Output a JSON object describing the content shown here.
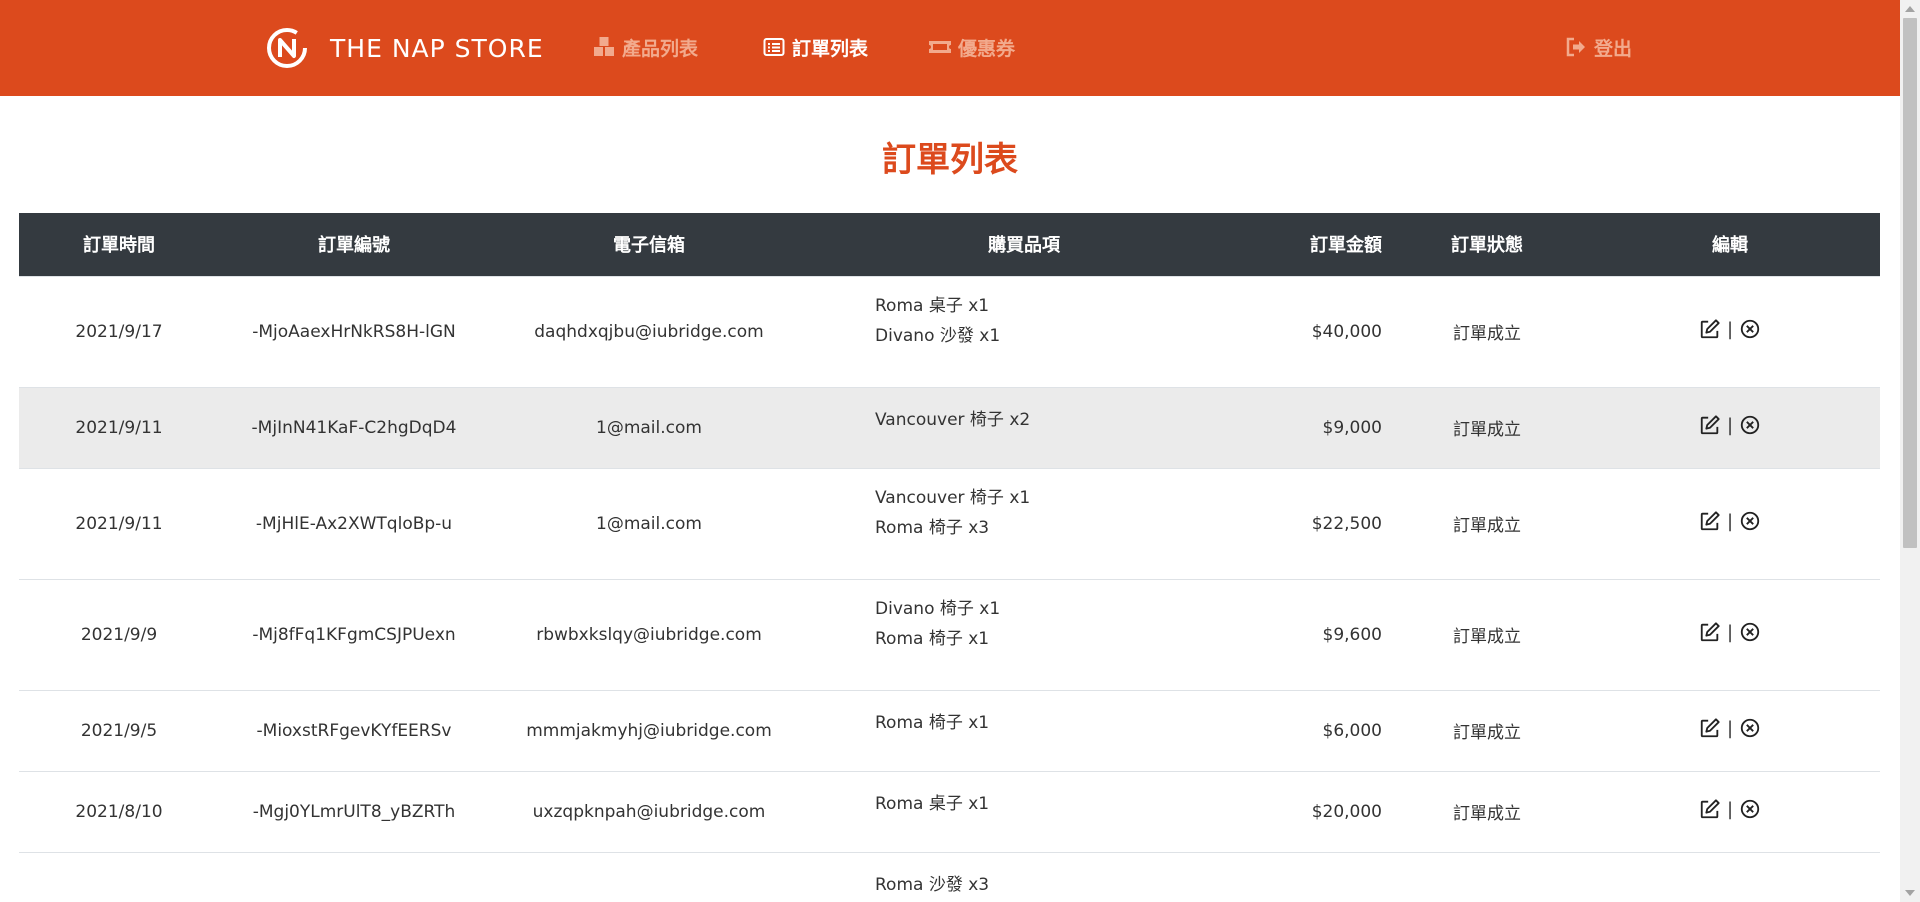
{
  "brand": {
    "name": "THE NAP STORE",
    "logo_icon": "nap-logo-icon"
  },
  "nav": {
    "products": {
      "label": "產品列表",
      "icon": "boxes-icon"
    },
    "orders": {
      "label": "訂單列表",
      "icon": "list-icon"
    },
    "coupons": {
      "label": "優惠券",
      "icon": "ticket-icon"
    },
    "logout": {
      "label": "登出",
      "icon": "sign-out-icon"
    }
  },
  "page": {
    "title": "訂單列表"
  },
  "table": {
    "headers": [
      "訂單時間",
      "訂單編號",
      "電子信箱",
      "購買品項",
      "訂單金額",
      "訂單狀態",
      "編輯"
    ],
    "rows": [
      {
        "time": "2021/9/17",
        "id": "-MjoAaexHrNkRS8H-lGN",
        "email": "daqhdxqjbu@iubridge.com",
        "items": [
          "Roma 桌子 x1",
          "Divano 沙發 x1"
        ],
        "amount": "$40,000",
        "status": "訂單成立"
      },
      {
        "time": "2021/9/11",
        "id": "-MjInN41KaF-C2hgDqD4",
        "email": "1@mail.com",
        "items": [
          "Vancouver 椅子 x2"
        ],
        "amount": "$9,000",
        "status": "訂單成立"
      },
      {
        "time": "2021/9/11",
        "id": "-MjHlE-Ax2XWTqloBp-u",
        "email": "1@mail.com",
        "items": [
          "Vancouver 椅子 x1",
          "Roma 椅子 x3"
        ],
        "amount": "$22,500",
        "status": "訂單成立"
      },
      {
        "time": "2021/9/9",
        "id": "-Mj8fFq1KFgmCSJPUexn",
        "email": "rbwbxkslqy@iubridge.com",
        "items": [
          "Divano 椅子 x1",
          "Roma 椅子 x1"
        ],
        "amount": "$9,600",
        "status": "訂單成立"
      },
      {
        "time": "2021/9/5",
        "id": "-MioxstRFgevKYfEERSv",
        "email": "mmmjakmyhj@iubridge.com",
        "items": [
          "Roma 椅子 x1"
        ],
        "amount": "$6,000",
        "status": "訂單成立"
      },
      {
        "time": "2021/8/10",
        "id": "-Mgj0YLmrUlT8_yBZRTh",
        "email": "uxzqpknpah@iubridge.com",
        "items": [
          "Roma 桌子 x1"
        ],
        "amount": "$20,000",
        "status": "訂單成立"
      },
      {
        "time": "",
        "id": "",
        "email": "",
        "items": [
          "Roma 沙發 x3"
        ],
        "amount": "",
        "status": ""
      }
    ],
    "edit_separator": "|"
  },
  "colors": {
    "primary": "#dc4a1d",
    "header_bg": "#343a40",
    "alt_row": "#ebebeb"
  }
}
